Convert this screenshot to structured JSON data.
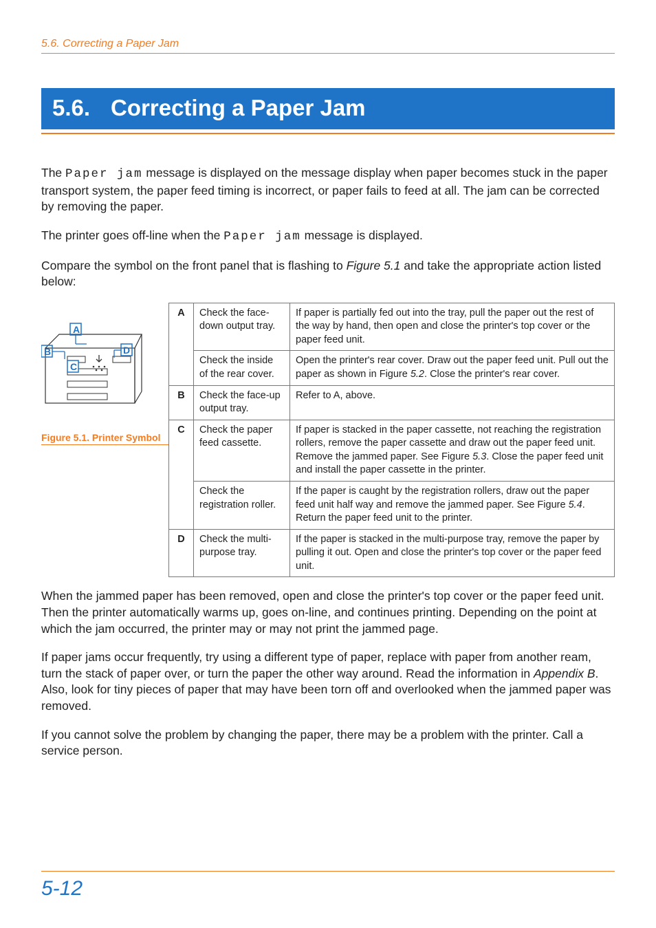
{
  "running_head": "5.6. Correcting a Paper Jam",
  "title_number": "5.6.",
  "title_text": "Correcting a Paper Jam",
  "intro_1a": "The ",
  "intro_1_code": "Paper jam",
  "intro_1b": " message is displayed on the message display when paper becomes stuck in the paper transport system, the paper feed timing is incorrect, or paper fails to feed at all. The jam can be corrected by removing the paper.",
  "intro_2a": "The printer goes off-line when the ",
  "intro_2_code": "Paper jam",
  "intro_2b": " message is displayed.",
  "intro_3a": "Compare the symbol on the front panel that is flashing to ",
  "intro_3_ref": "Figure 5.1",
  "intro_3b": " and take the appropriate action listed below:",
  "figure_caption": "Figure 5.1. Printer Symbol",
  "fig_labels": {
    "A": "A",
    "B": "B",
    "C": "C",
    "D": "D"
  },
  "table": {
    "A": {
      "letter": "A",
      "rows": [
        {
          "check": "Check the face-down output tray.",
          "action": "If paper is partially fed out into the tray, pull the paper out the rest of the way by hand, then open and close the printer's top cover or the paper feed unit."
        },
        {
          "check": "Check the inside of the rear cover.",
          "action_pre": "Open the printer's rear cover. Draw out the paper feed unit. Pull out the paper as shown in Figure ",
          "action_em": "5.2",
          "action_post": ". Close the printer's rear cover."
        }
      ]
    },
    "B": {
      "letter": "B",
      "rows": [
        {
          "check": "Check the face-up output tray.",
          "action": "Refer to A, above."
        }
      ]
    },
    "C": {
      "letter": "C",
      "rows": [
        {
          "check": "Check the paper feed cassette.",
          "action_pre": "If paper is stacked in the paper cassette, not reaching the registration rollers, remove the paper cassette and draw out the paper feed unit. Remove the jammed paper. See Figure ",
          "action_em": "5.3",
          "action_post": ". Close the paper feed unit and install the paper cassette in the printer."
        },
        {
          "check": "Check the registration roller.",
          "action_pre": "If the paper is caught by the registration rollers, draw out the paper feed unit half way and remove the jammed paper. See Figure ",
          "action_em": "5.4",
          "action_post": ". Return the paper feed unit to the printer."
        }
      ]
    },
    "D": {
      "letter": "D",
      "rows": [
        {
          "check": "Check the multi-purpose tray.",
          "action": "If the paper is stacked in the multi-purpose tray, remove the paper by pulling it out. Open and close the printer's top cover or the paper feed unit."
        }
      ]
    }
  },
  "para_after_1": "When the jammed paper has been removed, open and close the printer's top cover or the paper feed unit. Then the printer automatically warms up, goes on-line, and continues printing. Depending on the point at which the jam occurred, the printer may or may not print the jammed page.",
  "para_after_2a": "If paper jams occur frequently, try using a different type of paper, replace with paper from another ream, turn the stack of paper over, or turn the paper the other way around. Read the information in ",
  "para_after_2_em": "Appendix B",
  "para_after_2b": ". Also, look for tiny pieces of paper that may have been torn off and overlooked when the jammed paper was removed.",
  "para_after_3": "If you cannot solve the problem by changing the paper, there may be a problem with the printer. Call a service person.",
  "page_number": "5-12"
}
